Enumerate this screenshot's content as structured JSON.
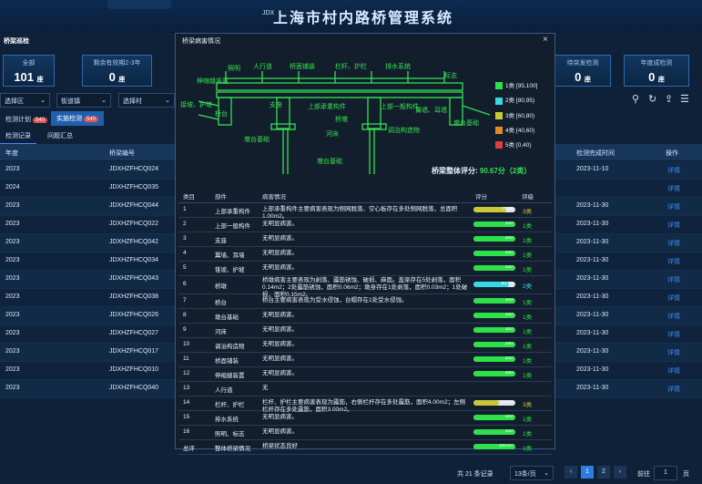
{
  "header": {
    "title": "上海市村内路桥管理系统",
    "top_left": "JDX",
    "nav_item": "JDX"
  },
  "left_panel_title": "桥梁巡检",
  "stats": [
    {
      "label": "全部",
      "value": "101",
      "unit": "座"
    },
    {
      "label": "剩余有效期2-3年",
      "value": "0",
      "unit": "座"
    },
    {
      "label": "待突发检测",
      "value": "0",
      "unit": "座"
    },
    {
      "label": "年度成检测",
      "value": "0",
      "unit": "座"
    }
  ],
  "filters": [
    "选择区",
    "街道镇",
    "选择村"
  ],
  "tabs": [
    {
      "label": "检测计划",
      "badge": "540"
    },
    {
      "label": "实施检测",
      "badge": "540"
    }
  ],
  "subtabs": [
    "检测记录",
    "问题汇总"
  ],
  "table": {
    "columns": [
      "年度",
      "桥梁编号",
      "检测完成时间",
      "操作"
    ],
    "rows": [
      {
        "year": "2023",
        "code": "JDXHZFHCQ024",
        "date": "2023-11-10",
        "op": "详情"
      },
      {
        "year": "2024",
        "code": "JDXHZFHCQ035",
        "date": "",
        "op": "详情"
      },
      {
        "year": "2023",
        "code": "JDXHZFHCQ044",
        "date": "2023-11-30",
        "op": "详情"
      },
      {
        "year": "2023",
        "code": "JDXHZFHCQ022",
        "date": "2023-11-30",
        "op": "详情"
      },
      {
        "year": "2023",
        "code": "JDXHZFHCQ042",
        "date": "2023-11-30",
        "op": "详情"
      },
      {
        "year": "2023",
        "code": "JDXHZFHCQ034",
        "date": "2023-11-30",
        "op": "详情"
      },
      {
        "year": "2023",
        "code": "JDXHZFHCQ043",
        "date": "2023-11-30",
        "op": "详情"
      },
      {
        "year": "2023",
        "code": "JDXHZFHCQ038",
        "date": "2023-11-30",
        "op": "详情"
      },
      {
        "year": "2023",
        "code": "JDXHZFHCQ026",
        "date": "2023-11-30",
        "op": "详情"
      },
      {
        "year": "2023",
        "code": "JDXHZFHCQ027",
        "date": "2023-11-30",
        "op": "详情"
      },
      {
        "year": "2023",
        "code": "JDXHZFHCQ017",
        "date": "2023-11-30",
        "op": "详情"
      },
      {
        "year": "2023",
        "code": "JDXHZFHCQ010",
        "date": "2023-11-30",
        "op": "详情"
      },
      {
        "year": "2023",
        "code": "JDXHZFHCQ040",
        "date": "2023-11-30",
        "op": "详情"
      }
    ]
  },
  "pagination": {
    "total": "共 21 条记录",
    "page_size": "13条/页",
    "pages": [
      "1",
      "2"
    ],
    "goto_label": "前往",
    "goto_value": "1",
    "page_unit": "页"
  },
  "modal": {
    "title": "桥梁病害情况",
    "diagram_labels": [
      "照明",
      "人行道",
      "桥面铺装",
      "栏杆、护栏",
      "排水系统",
      "标志",
      "伸缩缝装置",
      "接坡、护坡",
      "支座",
      "上部承重构件",
      "上部一般构件",
      "桥台",
      "桥墩",
      "翼墙、耳墙",
      "墩台基础",
      "河床",
      "调治构造物",
      "墩台基础",
      "墩台基础"
    ],
    "legend": [
      {
        "label": "1类 [95,100]",
        "color": "#2ee04a"
      },
      {
        "label": "2类 [80,95)",
        "color": "#37d9e6"
      },
      {
        "label": "3类 [60,80)",
        "color": "#c9c83a"
      },
      {
        "label": "4类 [40,60)",
        "color": "#e08a2a"
      },
      {
        "label": "5类 [0,40)",
        "color": "#e23b3b"
      }
    ],
    "score_label": "桥梁整体评分:",
    "score_value": "90.67分（2类）",
    "columns": [
      "类目",
      "部件",
      "病害情况",
      "评分",
      "评级"
    ],
    "rows": [
      {
        "no": "1",
        "part": "上部承重构件",
        "desc": "上部承重构件主要病害表现为侧网脱落、空心板存在多处侧网脱落，总面积1.00m2。",
        "score": 78.26,
        "score_text": "78.26",
        "grade": "3类",
        "color": "#c9c83a"
      },
      {
        "no": "2",
        "part": "上部一般构件",
        "desc": "无明显病害。",
        "score": 100,
        "score_text": "100",
        "grade": "1类",
        "color": "#2ee04a"
      },
      {
        "no": "3",
        "part": "支座",
        "desc": "无明显病害。",
        "score": 100,
        "score_text": "100",
        "grade": "1类",
        "color": "#2ee04a"
      },
      {
        "no": "4",
        "part": "翼墙、耳墙",
        "desc": "无明显病害。",
        "score": 100,
        "score_text": "100",
        "grade": "1类",
        "color": "#2ee04a"
      },
      {
        "no": "5",
        "part": "锥坡、护坡",
        "desc": "无明显病害。",
        "score": 100,
        "score_text": "100",
        "grade": "1类",
        "color": "#2ee04a"
      },
      {
        "no": "6",
        "part": "桥墩",
        "desc": "桥墩病害主要表现为剥落、露筋锈蚀、破损、麻面。盖梁存在5处剥落，面积0.14m2；2处露筋锈蚀，面积0.06m2；墩身存在1处剥落，面积0.03m2；1处破损，面积0.15m2。",
        "score": 83.74,
        "score_text": "83.74",
        "grade": "2类",
        "color": "#37d9e6"
      },
      {
        "no": "7",
        "part": "桥台",
        "desc": "桥台主要病害表现为受水侵蚀，台帽存在1处受水侵蚀。",
        "score": 100,
        "score_text": "100",
        "grade": "1类",
        "color": "#2ee04a"
      },
      {
        "no": "8",
        "part": "墩台基础",
        "desc": "无明显病害。",
        "score": 100,
        "score_text": "100",
        "grade": "1类",
        "color": "#2ee04a"
      },
      {
        "no": "9",
        "part": "河床",
        "desc": "无明显病害。",
        "score": 100,
        "score_text": "100",
        "grade": "1类",
        "color": "#2ee04a"
      },
      {
        "no": "10",
        "part": "调治构造物",
        "desc": "无明显病害。",
        "score": 100,
        "score_text": "100",
        "grade": "1类",
        "color": "#2ee04a"
      },
      {
        "no": "11",
        "part": "桥面铺装",
        "desc": "无明显病害。",
        "score": 100,
        "score_text": "100",
        "grade": "1类",
        "color": "#2ee04a"
      },
      {
        "no": "12",
        "part": "伸缩缝装置",
        "desc": "无明显病害。",
        "score": 100,
        "score_text": "100",
        "grade": "1类",
        "color": "#2ee04a"
      },
      {
        "no": "13",
        "part": "人行道",
        "desc": "无",
        "score": null,
        "score_text": "",
        "grade": "",
        "color": ""
      },
      {
        "no": "14",
        "part": "栏杆、护栏",
        "desc": "栏杆、护栏主要病害表现为露筋，右侧栏杆存在多处露筋，面积4.00m2；左侧栏杆存在多处露筋，面积3.00m2。",
        "score": 61.04,
        "score_text": "61.04",
        "grade": "3类",
        "color": "#c9c83a"
      },
      {
        "no": "15",
        "part": "排水系统",
        "desc": "无明显病害。",
        "score": 100,
        "score_text": "100",
        "grade": "1类",
        "color": "#2ee04a"
      },
      {
        "no": "16",
        "part": "照明、标志",
        "desc": "无明显病害。",
        "score": 100,
        "score_text": "100",
        "grade": "1类",
        "color": "#2ee04a"
      },
      {
        "no": "总评",
        "part": "整体桥梁情况",
        "desc": "桥梁状态良好",
        "score": 100,
        "score_text": "100.00",
        "grade": "1类",
        "color": "#2ee04a"
      }
    ]
  }
}
